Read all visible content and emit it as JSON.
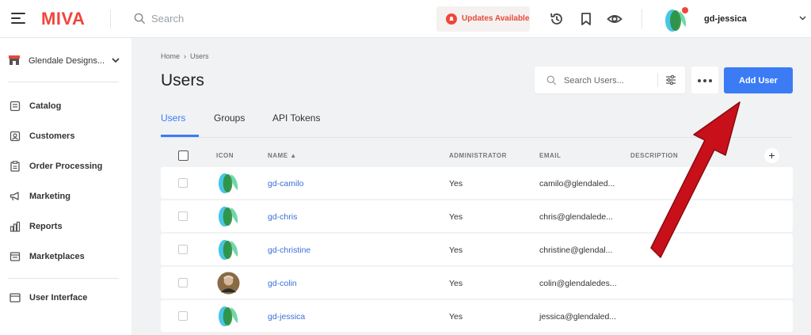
{
  "topbar": {
    "logo": "MIVA",
    "search_placeholder": "Search",
    "updates_label": "Updates Available",
    "user_name": "gd-jessica"
  },
  "sidebar": {
    "store_name": "Glendale Designs...",
    "items": [
      {
        "label": "Catalog",
        "icon": "catalog-icon"
      },
      {
        "label": "Customers",
        "icon": "customers-icon"
      },
      {
        "label": "Order Processing",
        "icon": "order-processing-icon"
      },
      {
        "label": "Marketing",
        "icon": "megaphone-icon"
      },
      {
        "label": "Reports",
        "icon": "bar-chart-icon"
      },
      {
        "label": "Marketplaces",
        "icon": "marketplaces-icon"
      },
      {
        "label": "User Interface",
        "icon": "user-interface-icon"
      }
    ]
  },
  "main": {
    "breadcrumb": [
      "Home",
      "Users"
    ],
    "title": "Users",
    "search_users_placeholder": "Search Users...",
    "add_user_label": "Add User",
    "tabs": [
      {
        "label": "Users",
        "active": true
      },
      {
        "label": "Groups",
        "active": false
      },
      {
        "label": "API Tokens",
        "active": false
      }
    ],
    "columns": {
      "icon": "ICON",
      "name": "NAME",
      "administrator": "ADMINISTRATOR",
      "email": "EMAIL",
      "description": "DESCRIPTION"
    },
    "rows": [
      {
        "name": "gd-camilo",
        "admin": "Yes",
        "email": "camilo@glendaled...",
        "avatar": "default"
      },
      {
        "name": "gd-chris",
        "admin": "Yes",
        "email": "chris@glendalede...",
        "avatar": "default"
      },
      {
        "name": "gd-christine",
        "admin": "Yes",
        "email": "christine@glendal...",
        "avatar": "default"
      },
      {
        "name": "gd-colin",
        "admin": "Yes",
        "email": "colin@glendaledes...",
        "avatar": "photo"
      },
      {
        "name": "gd-jessica",
        "admin": "Yes",
        "email": "jessica@glendaled...",
        "avatar": "default"
      }
    ]
  },
  "colors": {
    "brand": "#f0453a",
    "accent": "#3b7cf5",
    "link": "#3b6fd8",
    "annotation_arrow": "#c8101a"
  }
}
